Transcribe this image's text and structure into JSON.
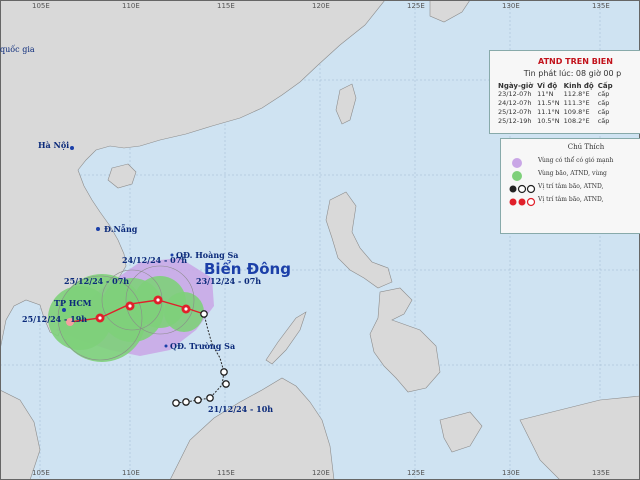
{
  "map": {
    "sea_name": "Biển Đông",
    "places": {
      "hanoi": "Hà Nội",
      "danang": "Đ.Nẵng",
      "hcm": "TP HCM",
      "hoangsa": "QĐ. Hoàng Sa",
      "truongsa": "QĐ. Trường Sa",
      "corner": "quốc gia"
    },
    "track_labels": {
      "p1": "24/12/24 - 07h",
      "p2": "23/12/24 - 07h",
      "p3": "25/12/24 - 07h",
      "p4": "25/12/24 - 19h",
      "p5": "21/12/24 - 10h"
    },
    "lon_ticks_top": [
      "105E",
      "110E",
      "115E",
      "120E",
      "125E",
      "130E",
      "135E"
    ],
    "lon_ticks_bottom": [
      "105E",
      "110E",
      "115E",
      "120E",
      "125E",
      "130E",
      "135E"
    ],
    "colors": {
      "sea": "#cfe3f2",
      "land": "#d8d8d8",
      "forecast_cone": "#c9a6e6",
      "strong_wind_zone": "#7ed07a",
      "track_past": "#2a2a2a",
      "track_forecast": "#e0202a"
    }
  },
  "info": {
    "title": "ATND TREN BIEN",
    "issued": "Tin phát lúc: 08 giờ 00 p",
    "headers": [
      "Ngày-giờ",
      "Vĩ độ",
      "Kinh độ",
      "Cấp"
    ],
    "rows": [
      [
        "23/12-07h",
        "11°N",
        "112.8°E",
        "cấp"
      ],
      [
        "24/12-07h",
        "11.5°N",
        "111.3°E",
        "cấp"
      ],
      [
        "25/12-07h",
        "11.1°N",
        "109.8°E",
        "cấp"
      ],
      [
        "25/12-19h",
        "10.5°N",
        "108.2°E",
        "cấp"
      ]
    ]
  },
  "legend": {
    "title": "Chú Thích",
    "items": [
      {
        "text": "Vùng có thể có gió mạnh",
        "icon": "purple-circle-icon"
      },
      {
        "text": "Vùng bão, ATND, vùng",
        "icon": "green-circle-icon"
      },
      {
        "text": "Vị trí tâm bão, ATND,",
        "icon": "black-storm-symbols-icon"
      },
      {
        "text": "Vị trí tâm bão, ATND,",
        "icon": "red-storm-symbols-icon"
      }
    ]
  }
}
